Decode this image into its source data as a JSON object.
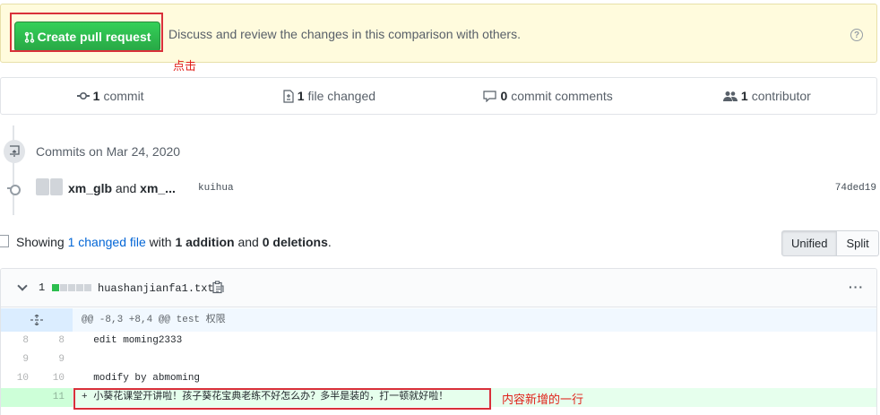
{
  "banner": {
    "button_label": "Create pull request",
    "description": "Discuss and review the changes in this comparison with others.",
    "help_glyph": "?",
    "click_annotation": "点击"
  },
  "numbers": {
    "commits_count": "1",
    "commits_label": "commit",
    "files_count": "1",
    "files_label": "file changed",
    "comments_count": "0",
    "comments_label": "commit comments",
    "contributors_count": "1",
    "contributors_label": "contributor"
  },
  "commits": {
    "heading": "Commits on Mar 24, 2020",
    "author1": "xm_glb",
    "and_text": " and ",
    "author2": "xm_...",
    "message": "kuihua",
    "sha": "74ded19"
  },
  "toc": {
    "showing": "Showing ",
    "changed_link": "1 changed file",
    "with_text": " with ",
    "additions": "1 addition",
    "and_text": " and ",
    "deletions": "0 deletions",
    "period": "."
  },
  "diff_toggle": {
    "unified": "Unified",
    "split": "Split"
  },
  "file": {
    "change_count": "1",
    "diffstat": {
      "additions": 1,
      "blocks": 5
    },
    "name": "huashanjianfa1.txt",
    "more_glyph": "···"
  },
  "diff": {
    "hunk_header": "@@ -8,3 +8,4 @@ test 权限",
    "lines": [
      {
        "old": "8",
        "new": "8",
        "text": "  edit moming2333",
        "type": "context"
      },
      {
        "old": "9",
        "new": "9",
        "text": "",
        "type": "context"
      },
      {
        "old": "10",
        "new": "10",
        "text": "  modify by abmoming",
        "type": "context"
      },
      {
        "old": "",
        "new": "11",
        "text": "+ 小葵花课堂开讲啦！孩子葵花宝典老练不好怎么办？多半是装的，打一顿就好啦！",
        "type": "add"
      }
    ],
    "added_annotation": "内容新增的一行"
  },
  "colors": {
    "accent_green": "#28a745",
    "banner_bg": "#fffbdd",
    "link_blue": "#0366d6",
    "annotation_red": "#e0211a",
    "added_line_bg": "#e6ffed"
  },
  "icons": [
    "git-pull-request-icon",
    "help-icon",
    "commit-icon",
    "file-diff-icon",
    "comment-icon",
    "people-icon",
    "repo-push-icon",
    "chevron-down-icon",
    "clippy-icon",
    "kebab-horizontal-icon",
    "unfold-icon"
  ]
}
